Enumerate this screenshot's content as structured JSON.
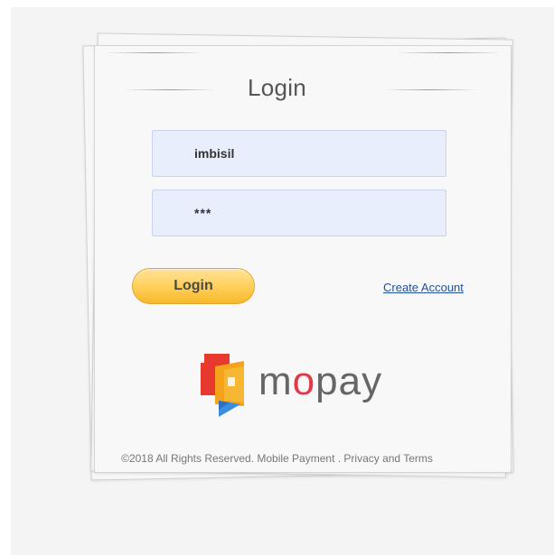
{
  "login": {
    "title": "Login",
    "username_value": "imbisil",
    "password_value": "***",
    "submit_label": "Login",
    "create_account_label": "Create Account"
  },
  "brand": {
    "wordmark_prefix": "m",
    "wordmark_accent": "o",
    "wordmark_suffix": "pay",
    "logo_icon": "mopay-wallet-icon",
    "accent_color": "#e03a4d"
  },
  "footer": {
    "text": "©2018 All Rights Reserved. Mobile Payment . Privacy and Terms"
  },
  "colors": {
    "button": "#ffce55",
    "input_background": "#e9eefc",
    "link": "#1f4f9a"
  }
}
